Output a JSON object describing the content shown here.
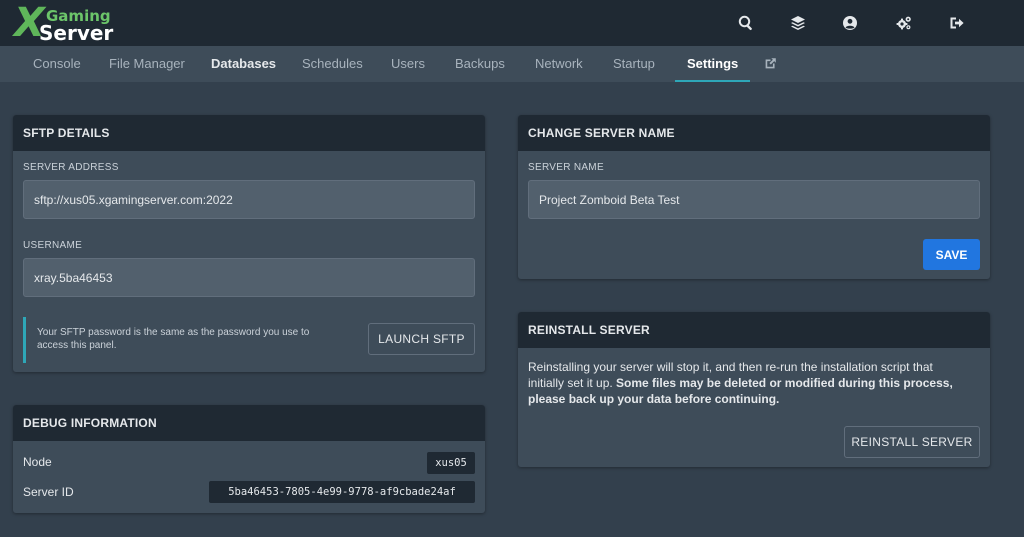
{
  "brand": {
    "mark": "X",
    "line1": "Gaming",
    "line2": "Server"
  },
  "top_icons": [
    "search-icon",
    "layers-icon",
    "user-circle-icon",
    "cogs-icon",
    "sign-out-icon"
  ],
  "tabs": [
    {
      "label": "Console",
      "state": "normal"
    },
    {
      "label": "File Manager",
      "state": "normal"
    },
    {
      "label": "Databases",
      "state": "bold"
    },
    {
      "label": "Schedules",
      "state": "normal"
    },
    {
      "label": "Users",
      "state": "normal"
    },
    {
      "label": "Backups",
      "state": "normal"
    },
    {
      "label": "Network",
      "state": "normal"
    },
    {
      "label": "Startup",
      "state": "normal"
    },
    {
      "label": "Settings",
      "state": "active"
    }
  ],
  "sftp": {
    "title": "SFTP DETAILS",
    "address_label": "SERVER ADDRESS",
    "address_value": "sftp://xus05.xgamingserver.com:2022",
    "username_label": "USERNAME",
    "username_value": "xray.5ba46453",
    "note": "Your SFTP password is the same as the password you use to access this panel.",
    "launch_label": "LAUNCH SFTP"
  },
  "debug": {
    "title": "DEBUG INFORMATION",
    "node_label": "Node",
    "node_value": "xus05",
    "server_id_label": "Server ID",
    "server_id_value": "5ba46453-7805-4e99-9778-af9cbade24af"
  },
  "rename": {
    "title": "CHANGE SERVER NAME",
    "name_label": "SERVER NAME",
    "name_value": "Project Zomboid Beta Test",
    "save_label": "SAVE"
  },
  "reinstall": {
    "title": "REINSTALL SERVER",
    "text_plain": "Reinstalling your server will stop it, and then re-run the installation script that initially set it up.",
    "text_bold": "Some files may be deleted or modified during this process, please back up your data before continuing.",
    "button_label": "REINSTALL SERVER"
  },
  "colors": {
    "accent": "#2ea7b8",
    "primary": "#2176e0",
    "brand_green": "#5fb65a"
  }
}
